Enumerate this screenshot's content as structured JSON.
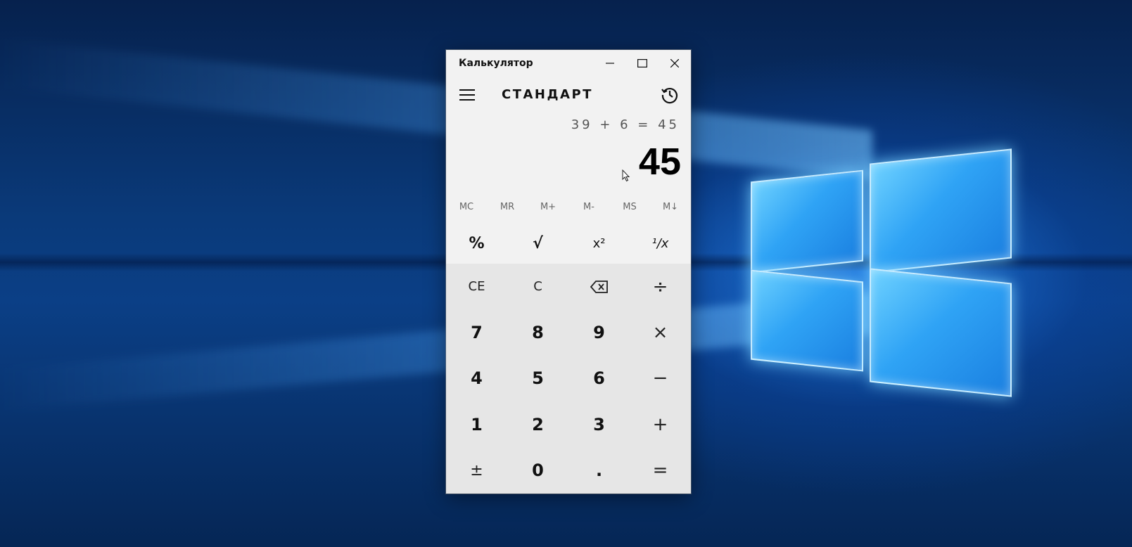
{
  "window": {
    "title": "Калькулятор"
  },
  "header": {
    "mode": "СТАНДАРТ"
  },
  "display": {
    "expression": "39 + 6 = 45",
    "result": "45"
  },
  "memory": {
    "mc": "MC",
    "mr": "MR",
    "m_plus": "M+",
    "m_minus": "M-",
    "ms": "MS",
    "m_list": "M↓"
  },
  "scientific": {
    "percent": "%",
    "sqrt": "√",
    "square": "x²",
    "reciprocal": "¹/x"
  },
  "keys": {
    "ce": "CE",
    "c": "C",
    "divide": "÷",
    "d7": "7",
    "d8": "8",
    "d9": "9",
    "multiply": "×",
    "d4": "4",
    "d5": "5",
    "d6": "6",
    "minus": "−",
    "d1": "1",
    "d2": "2",
    "d3": "3",
    "plus": "+",
    "negate": "±",
    "d0": "0",
    "decimal": ".",
    "equals": "="
  }
}
